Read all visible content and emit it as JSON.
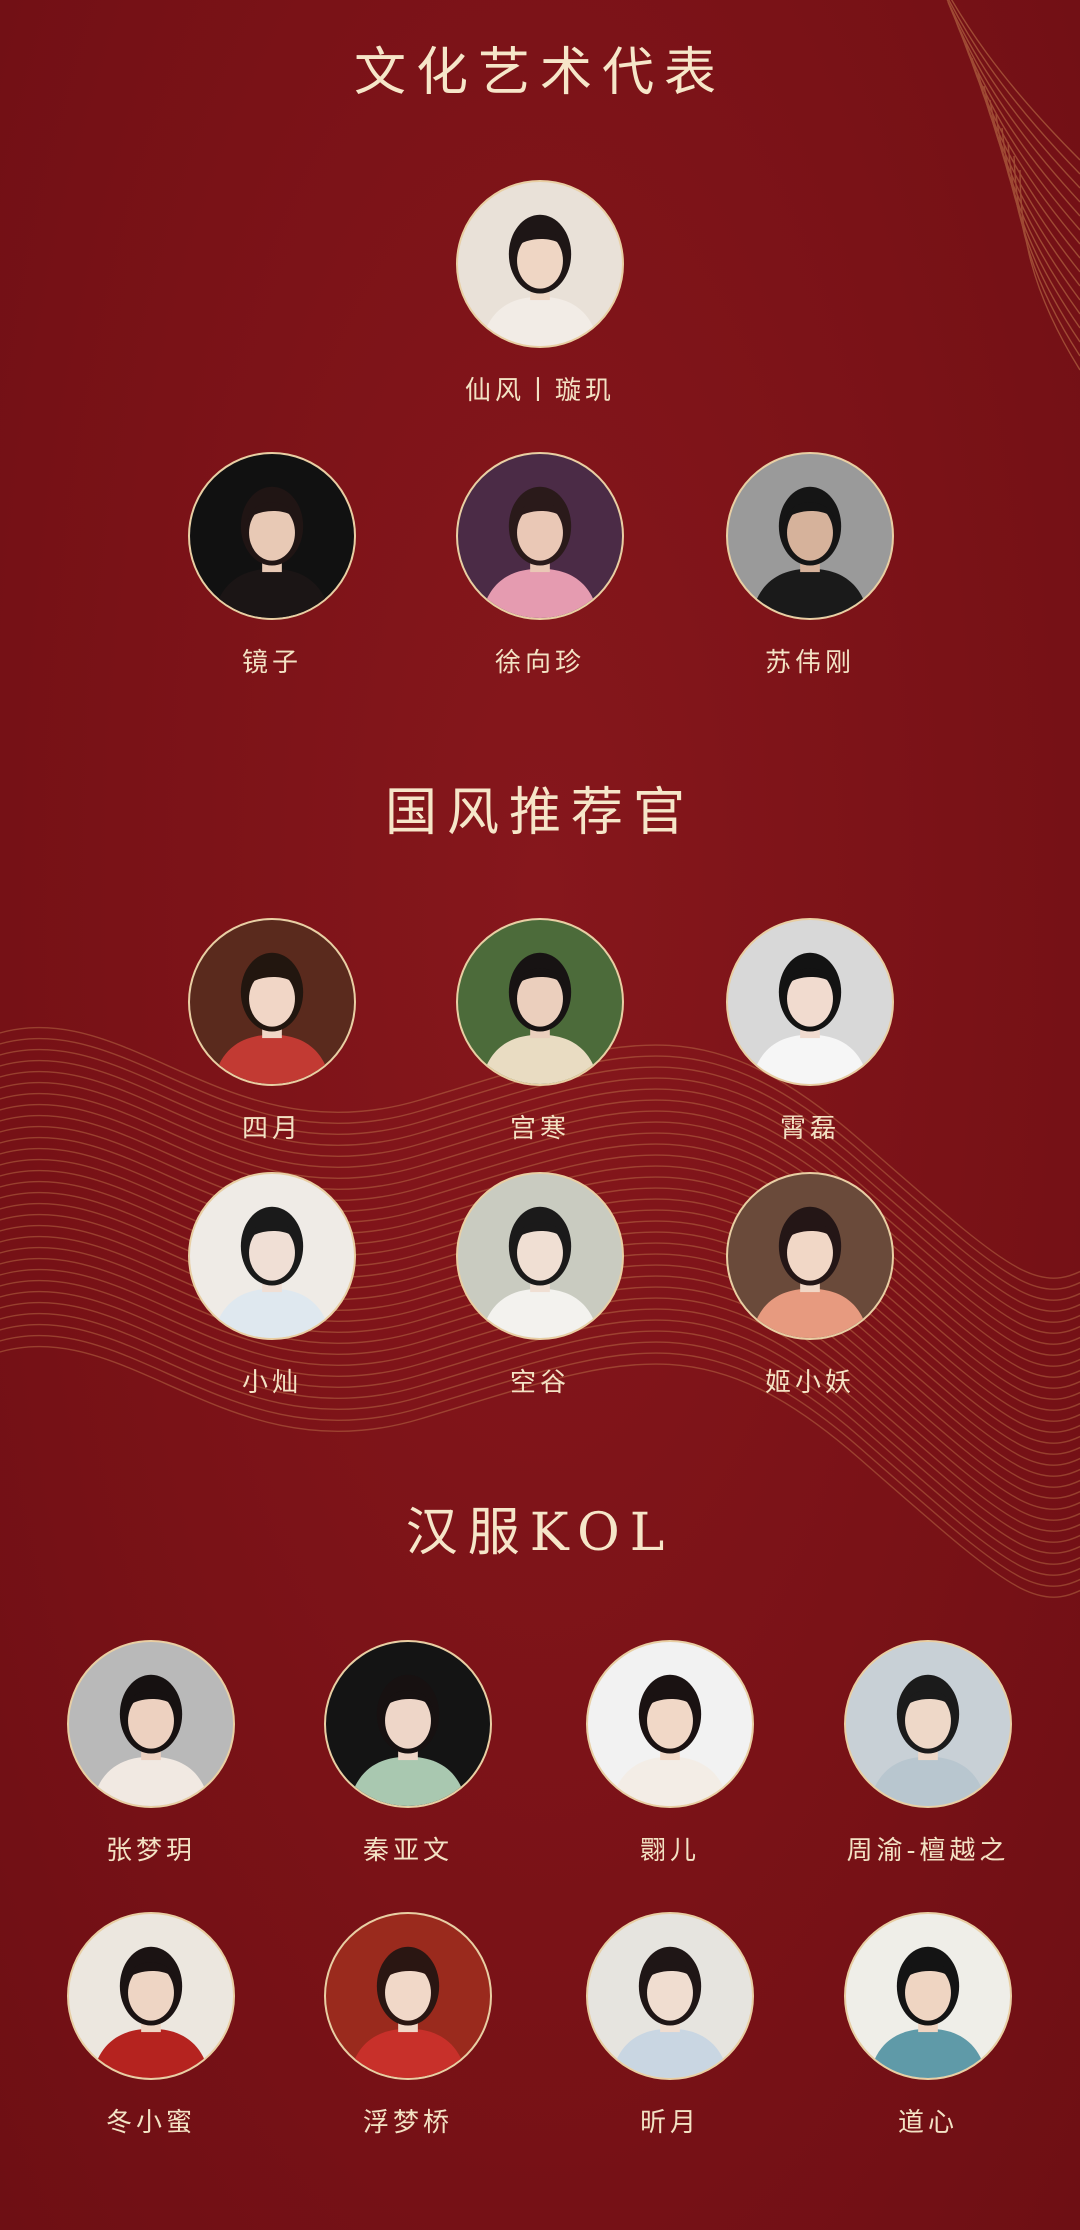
{
  "sections": [
    {
      "title": "文化艺术代表",
      "people": [
        {
          "name": "仙风丨璇玑",
          "palette": {
            "bg": "#e9e1d8",
            "hair": "#1e1616",
            "skin": "#efd6c4",
            "cloth": "#f2ece6"
          }
        },
        {
          "name": "镜子",
          "palette": {
            "bg": "#111111",
            "hair": "#201514",
            "skin": "#e8c9b5",
            "cloth": "#1b1515"
          }
        },
        {
          "name": "徐向珍",
          "palette": {
            "bg": "#4b2b46",
            "hair": "#2a1a1a",
            "skin": "#eac8b6",
            "cloth": "#e59bb0"
          }
        },
        {
          "name": "苏伟刚",
          "palette": {
            "bg": "#9a9a9a",
            "hair": "#151515",
            "skin": "#d6b29b",
            "cloth": "#1a1a1a"
          }
        }
      ]
    },
    {
      "title": "国风推荐官",
      "people": [
        {
          "name": "四月",
          "palette": {
            "bg": "#5a2a1d",
            "hair": "#22160f",
            "skin": "#f1d6c6",
            "cloth": "#c23a33"
          }
        },
        {
          "name": "宫寒",
          "palette": {
            "bg": "#4c6b3a",
            "hair": "#171313",
            "skin": "#ebcfbd",
            "cloth": "#e9dcc2"
          }
        },
        {
          "name": "霄磊",
          "palette": {
            "bg": "#d8d8d8",
            "hair": "#131313",
            "skin": "#f1dbcf",
            "cloth": "#f6f6f6"
          }
        },
        {
          "name": "小灿",
          "palette": {
            "bg": "#efebe6",
            "hair": "#1a1a1a",
            "skin": "#f0dfd5",
            "cloth": "#dfe8ef"
          }
        },
        {
          "name": "空谷",
          "palette": {
            "bg": "#c9cbc0",
            "hair": "#1b1a1a",
            "skin": "#f0dfd3",
            "cloth": "#f3f2ee"
          }
        },
        {
          "name": "姬小妖",
          "palette": {
            "bg": "#6a4a3a",
            "hair": "#241616",
            "skin": "#f1d7c6",
            "cloth": "#e79a7f"
          }
        }
      ]
    },
    {
      "title": "汉服KOL",
      "people": [
        {
          "name": "张梦玥",
          "palette": {
            "bg": "#b9b9b9",
            "hair": "#161111",
            "skin": "#edd1c0",
            "cloth": "#f1e9e2"
          }
        },
        {
          "name": "秦亚文",
          "palette": {
            "bg": "#141414",
            "hair": "#171111",
            "skin": "#eed6c8",
            "cloth": "#a9c8b0"
          }
        },
        {
          "name": "翾儿",
          "palette": {
            "bg": "#f2f2f2",
            "hair": "#1a1212",
            "skin": "#f1d8c7",
            "cloth": "#f3ede6"
          }
        },
        {
          "name": "周渝-檀越之",
          "palette": {
            "bg": "#c8d0d6",
            "hair": "#1b1b1b",
            "skin": "#eed8c8",
            "cloth": "#b8c6cf"
          }
        },
        {
          "name": "冬小蜜",
          "palette": {
            "bg": "#ece7df",
            "hair": "#1b1313",
            "skin": "#eed5c4",
            "cloth": "#b5231f"
          }
        },
        {
          "name": "浮梦桥",
          "palette": {
            "bg": "#9a2a1d",
            "hair": "#2a1612",
            "skin": "#f1d8c8",
            "cloth": "#c8302a"
          }
        },
        {
          "name": "昕月",
          "palette": {
            "bg": "#e6e4df",
            "hair": "#1f1616",
            "skin": "#f0ddd0",
            "cloth": "#c9d6e2"
          }
        },
        {
          "name": "道心",
          "palette": {
            "bg": "#efeee8",
            "hair": "#141414",
            "skin": "#efd5c2",
            "cloth": "#5f9aa8"
          }
        }
      ]
    }
  ]
}
